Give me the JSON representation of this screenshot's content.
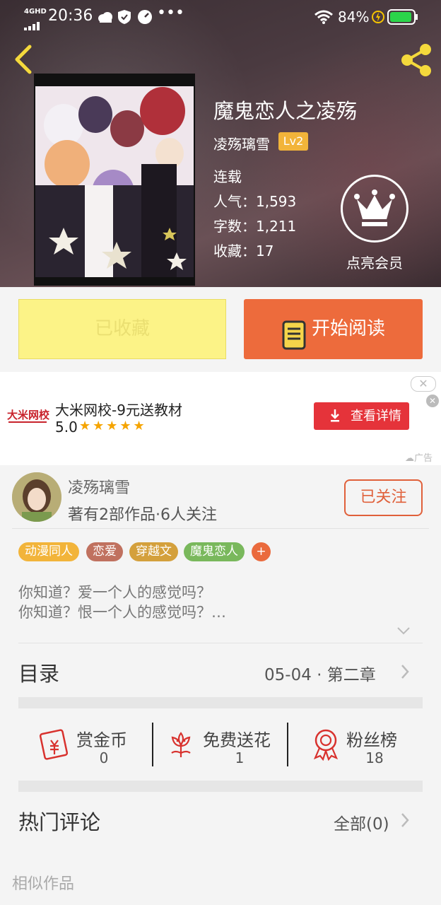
{
  "status_bar": {
    "network": "4GHD",
    "time": "20:36",
    "battery": "84%"
  },
  "book": {
    "title": "魔鬼恋人之凌殇",
    "author": "凌殇璃雪",
    "level": "Lv2",
    "status": "连载",
    "popularity": "人气：1,593",
    "word_count": "字数：1,211",
    "favorites": "收藏：17"
  },
  "vip": {
    "label": "点亮会员"
  },
  "actions": {
    "collected_label": "已收藏",
    "read_label": "开始阅读"
  },
  "ad": {
    "brand_logo_text": "大米网校",
    "title": "大米网校-9元送教材",
    "rating": "5.0",
    "stars": 5,
    "cta": "查看详情",
    "ad_tag": "广告"
  },
  "author_card": {
    "name": "凌殇璃雪",
    "info": "著有2部作品·6人关注",
    "follow_label": "已关注"
  },
  "tags": [
    "动漫同人",
    "恋爱",
    "穿越文",
    "魔鬼恋人",
    "+"
  ],
  "tag_colors": [
    "#f2b43a",
    "#c0715f",
    "#d4a03c",
    "#79b85c",
    "#ea6a3d"
  ],
  "synopsis": {
    "line1": "你知道？爱一个人的感觉吗？",
    "line2": "你知道？恨一个人的感觉吗？…"
  },
  "catalog": {
    "label": "目录",
    "latest": "05-04 · 第二章"
  },
  "stats": {
    "reward": {
      "label": "赏金币",
      "value": "0"
    },
    "flower": {
      "label": "免费送花",
      "value": "1"
    },
    "fans": {
      "label": "粉丝榜",
      "value": "18"
    }
  },
  "comments": {
    "label": "热门评论",
    "all": "全部(0)"
  },
  "similar": {
    "label": "相似作品"
  },
  "colors": {
    "accent": "#ed6b3c",
    "collected_bg": "#fcf387",
    "ad_button": "#e5333a",
    "icon_red": "#d8322e"
  }
}
